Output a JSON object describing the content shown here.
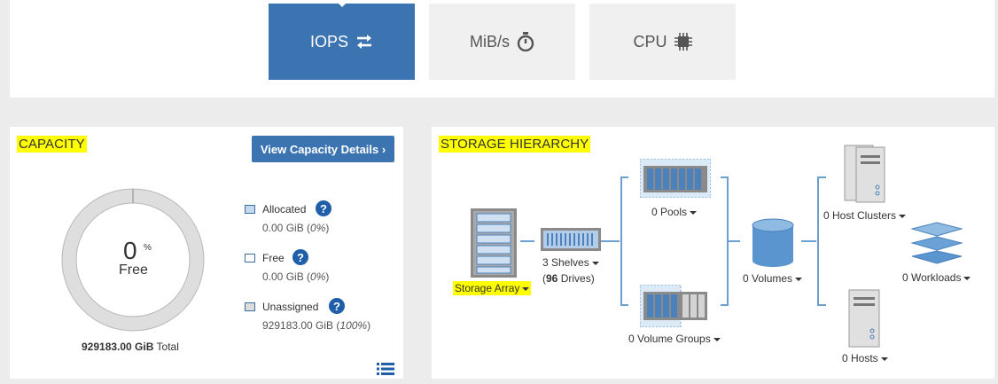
{
  "perf_tabs": [
    {
      "label": "IOPS",
      "icon": "swap-arrows-icon",
      "active": true
    },
    {
      "label": "MiB/s",
      "icon": "stopwatch-icon",
      "active": false
    },
    {
      "label": "CPU",
      "icon": "chip-icon",
      "active": false
    }
  ],
  "capacity": {
    "title": "CAPACITY",
    "details_button": "View Capacity Details ›",
    "donut": {
      "percent": "0",
      "percent_sign": "%",
      "label": "Free"
    },
    "total_value": "929183.00 GiB",
    "total_suffix": "Total",
    "legend": [
      {
        "label": "Allocated",
        "value": "0.00 GiB (",
        "pct": "0%",
        "close": ")",
        "color": "#c5d9ec"
      },
      {
        "label": "Free",
        "value": "0.00 GiB (",
        "pct": "0%",
        "close": ")",
        "color": "#ffffff"
      },
      {
        "label": "Unassigned",
        "value": "929183.00 GiB (",
        "pct": "100%",
        "close": ")",
        "color": "#dddddd"
      }
    ],
    "help_glyph": "?",
    "list_icon": "list-icon"
  },
  "hierarchy": {
    "title": "STORAGE HIERARCHY",
    "storage_array": "Storage Array",
    "shelves": "3 Shelves",
    "drives_open": "(",
    "drives_count": "96",
    "drives_rest": " Drives)",
    "pools": "0 Pools",
    "volume_groups": "0 Volume Groups",
    "volumes": "0 Volumes",
    "host_clusters": "0 Host Clusters",
    "hosts": "0 Hosts",
    "workloads": "0 Workloads"
  },
  "colors": {
    "accent": "#3c74b2",
    "highlight": "#ffff00",
    "icon_blue": "#6a9fd0"
  }
}
